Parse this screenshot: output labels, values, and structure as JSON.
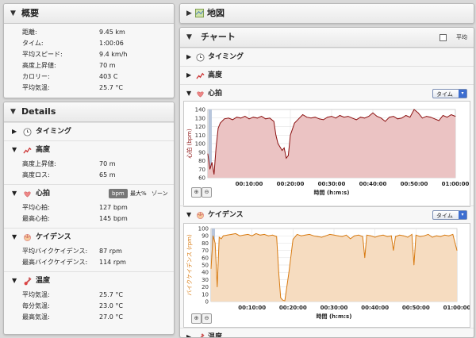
{
  "summary": {
    "title": "概要",
    "rows": [
      {
        "label": "距離:",
        "value": "9.45 km"
      },
      {
        "label": "タイム:",
        "value": "1:00:06"
      },
      {
        "label": "平均スピード:",
        "value": "9.4 km/h"
      },
      {
        "label": "高度上昇値:",
        "value": "70 m"
      },
      {
        "label": "カロリー:",
        "value": "403 C"
      },
      {
        "label": "平均気温:",
        "value": "25.7 °C"
      }
    ]
  },
  "details": {
    "title": "Details",
    "timing": {
      "label": "タイミング"
    },
    "elevation": {
      "label": "高度",
      "rows": [
        {
          "label": "高度上昇値:",
          "value": "70 m"
        },
        {
          "label": "高度ロス:",
          "value": "65 m"
        }
      ]
    },
    "heart": {
      "label": "心拍",
      "tabs": [
        "bpm",
        "最大%",
        "ゾーン"
      ],
      "rows": [
        {
          "label": "平均心拍:",
          "value": "127 bpm"
        },
        {
          "label": "最高心拍:",
          "value": "145 bpm"
        }
      ]
    },
    "cadence": {
      "label": "ケイデンス",
      "rows": [
        {
          "label": "平均バイクケイデンス:",
          "value": "87 rpm"
        },
        {
          "label": "最高バイクケイデンス:",
          "value": "114 rpm"
        }
      ]
    },
    "temperature": {
      "label": "温度",
      "rows": [
        {
          "label": "平均気温:",
          "value": "25.7 °C"
        },
        {
          "label": "毎分気温:",
          "value": "23.0 °C"
        },
        {
          "label": "最高気温:",
          "value": "27.0 °C"
        }
      ]
    }
  },
  "map": {
    "title": "地図"
  },
  "charts": {
    "title": "チャート",
    "avg_label": "平均",
    "timing_label": "タイミング",
    "elevation_label": "高度",
    "heart_label": "心拍",
    "cadence_label": "ケイデンス",
    "temp_label": "温度",
    "dropdown_value": "タイム"
  },
  "colors": {
    "heart": "#8b1010",
    "heart_fill": "#ebc3c3",
    "cadence": "#d87a10",
    "cadence_fill": "#f6dcc0",
    "panel_bg": "#f7f7f7"
  },
  "chart_data": [
    {
      "type": "area",
      "ylabel": "心拍 (bpm)",
      "xlabel": "時間 (h:m:s)",
      "ylim": [
        60,
        140
      ],
      "yticks": [
        60,
        70,
        80,
        90,
        100,
        110,
        120,
        130,
        140
      ],
      "xlim": [
        0,
        60
      ],
      "xticks": [
        {
          "value": 10,
          "label": "00:10:00"
        },
        {
          "value": 20,
          "label": "00:20:00"
        },
        {
          "value": 30,
          "label": "00:30:00"
        },
        {
          "value": 40,
          "label": "00:40:00"
        },
        {
          "value": 50,
          "label": "00:50:00"
        },
        {
          "value": 60,
          "label": "01:00:00"
        }
      ],
      "grid": true,
      "x": [
        0,
        0.5,
        1,
        1.5,
        2,
        2.5,
        3,
        4,
        5,
        6,
        7,
        8,
        9,
        10,
        11,
        12,
        13,
        14,
        15,
        16,
        16.5,
        17,
        17.5,
        18,
        18.5,
        19,
        19.5,
        20,
        21,
        22,
        23,
        24,
        25,
        26,
        27,
        28,
        29,
        30,
        31,
        32,
        33,
        34,
        35,
        36,
        37,
        38,
        39,
        40,
        41,
        42,
        43,
        44,
        45,
        46,
        47,
        48,
        49,
        50,
        51,
        52,
        53,
        54,
        55,
        56,
        57,
        58,
        59,
        60
      ],
      "y": [
        88,
        70,
        78,
        64,
        96,
        118,
        124,
        129,
        130,
        128,
        131,
        130,
        132,
        129,
        131,
        130,
        132,
        129,
        130,
        126,
        110,
        100,
        96,
        92,
        95,
        83,
        86,
        110,
        124,
        129,
        134,
        131,
        130,
        131,
        129,
        128,
        131,
        132,
        130,
        133,
        131,
        132,
        130,
        128,
        131,
        130,
        132,
        136,
        132,
        130,
        126,
        131,
        132,
        129,
        130,
        133,
        131,
        140,
        136,
        130,
        132,
        131,
        129,
        127,
        133,
        131,
        134,
        132
      ]
    },
    {
      "type": "area",
      "ylabel": "バイクケイデンス (rpm)",
      "xlabel": "時間 (h:m:s)",
      "ylim": [
        0,
        100
      ],
      "yticks": [
        0,
        10,
        20,
        30,
        40,
        50,
        60,
        70,
        80,
        90,
        100
      ],
      "xlim": [
        0,
        60
      ],
      "xticks": [
        {
          "value": 10,
          "label": "00:10:00"
        },
        {
          "value": 20,
          "label": "00:20:00"
        },
        {
          "value": 30,
          "label": "00:30:00"
        },
        {
          "value": 40,
          "label": "00:40:00"
        },
        {
          "value": 50,
          "label": "00:50:00"
        },
        {
          "value": 60,
          "label": "01:00:00"
        }
      ],
      "grid": true,
      "x": [
        0,
        0.5,
        1,
        1.5,
        2,
        2.5,
        3,
        4,
        5,
        6,
        7,
        8,
        9,
        10,
        11,
        12,
        13,
        14,
        15,
        16,
        16.5,
        17,
        17.5,
        18,
        19,
        20,
        21,
        22,
        23,
        24,
        25,
        26,
        27,
        28,
        29,
        30,
        31,
        32,
        33,
        34,
        35,
        36,
        37,
        37.5,
        38,
        39,
        40,
        41,
        42,
        43,
        44,
        44.5,
        45,
        46,
        47,
        48,
        49,
        49.5,
        50,
        51,
        52,
        53,
        54,
        55,
        56,
        57,
        58,
        59,
        60
      ],
      "y": [
        45,
        90,
        80,
        20,
        88,
        86,
        90,
        91,
        92,
        93,
        90,
        91,
        92,
        90,
        93,
        91,
        92,
        90,
        91,
        89,
        40,
        5,
        2,
        1,
        40,
        85,
        92,
        90,
        91,
        92,
        90,
        89,
        88,
        90,
        92,
        91,
        90,
        89,
        91,
        86,
        90,
        91,
        89,
        60,
        91,
        90,
        88,
        90,
        91,
        89,
        90,
        70,
        89,
        91,
        90,
        88,
        92,
        50,
        91,
        89,
        90,
        92,
        88,
        90,
        89,
        91,
        90,
        92,
        70
      ]
    }
  ]
}
